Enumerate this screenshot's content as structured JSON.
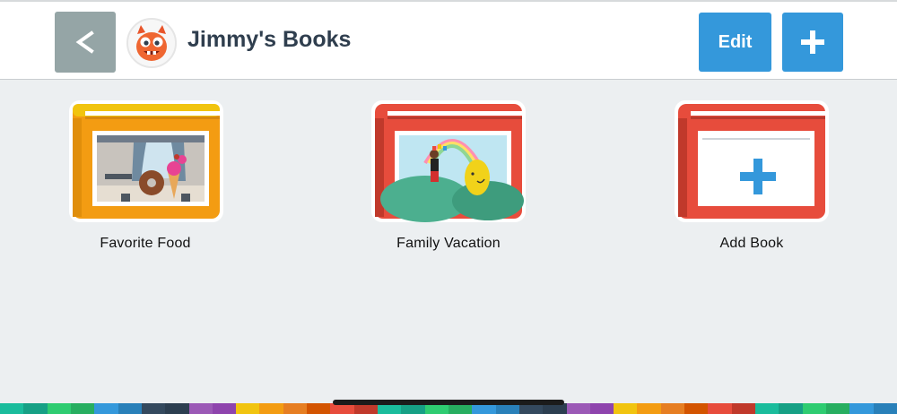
{
  "header": {
    "back_label": "<",
    "title": "Jimmy's Books",
    "edit_label": "Edit",
    "add_label": "+"
  },
  "books": [
    {
      "label": "Favorite Food",
      "color": "#f39c12"
    },
    {
      "label": "Family Vacation",
      "color": "#e74c3c"
    },
    {
      "label": "Add Book",
      "color": "#e74c3c"
    }
  ],
  "colors": {
    "header_bg": "#ffffff",
    "page_bg": "#eceff1",
    "accent_blue": "#3498db",
    "back_gray": "#95a5a6",
    "title_text": "#2f3e4e",
    "stripes": [
      "#1abc9c",
      "#16a085",
      "#2ecc71",
      "#27ae60",
      "#3498db",
      "#2980b9",
      "#34495e",
      "#2c3e50",
      "#9b59b6",
      "#8e44ad",
      "#f1c40f",
      "#f39c12",
      "#e67e22",
      "#d35400",
      "#e74c3c",
      "#c0392b",
      "#1abc9c",
      "#16a085",
      "#2ecc71",
      "#27ae60",
      "#3498db",
      "#2980b9",
      "#34495e",
      "#2c3e50",
      "#9b59b6",
      "#8e44ad",
      "#f1c40f",
      "#f39c12",
      "#e67e22",
      "#d35400",
      "#e74c3c",
      "#c0392b",
      "#1abc9c",
      "#16a085",
      "#2ecc71",
      "#27ae60",
      "#3498db",
      "#2980b9"
    ]
  },
  "icons": {
    "back": "chevron-left-icon",
    "avatar": "monster-avatar-icon",
    "add": "plus-icon"
  }
}
